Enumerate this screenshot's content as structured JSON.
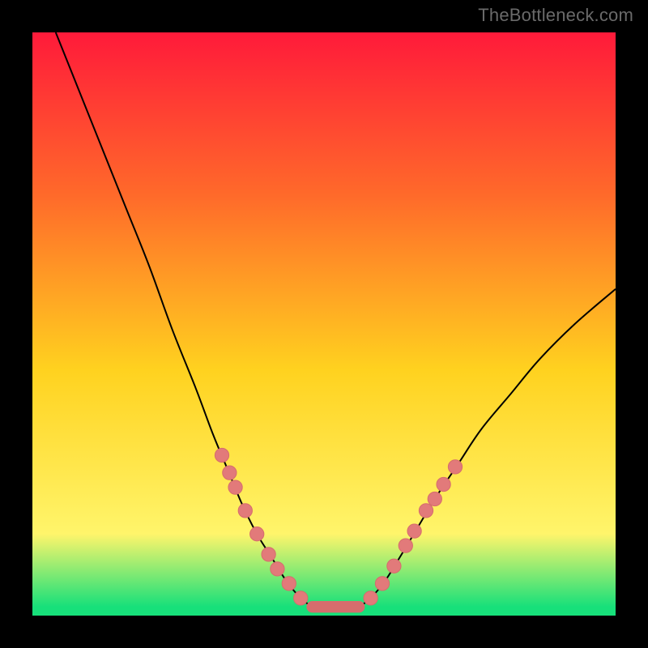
{
  "watermark": "TheBottleneck.com",
  "colors": {
    "gradient_top": "#ff1a3a",
    "gradient_mid1": "#ff6a2a",
    "gradient_mid2": "#ffd21f",
    "gradient_mid3": "#fff56b",
    "gradient_bottom": "#17e07a",
    "curve": "#000000",
    "marker_fill": "#e27a7a",
    "marker_stroke": "#d66d6d",
    "flat_line": "#d66d6d"
  },
  "chart_data": {
    "type": "line",
    "title": "",
    "xlabel": "",
    "ylabel": "",
    "xlim": [
      0,
      100
    ],
    "ylim": [
      0,
      100
    ],
    "left_curve": [
      {
        "x": 4,
        "y": 100
      },
      {
        "x": 8,
        "y": 90
      },
      {
        "x": 12,
        "y": 80
      },
      {
        "x": 16,
        "y": 70
      },
      {
        "x": 20,
        "y": 60
      },
      {
        "x": 24,
        "y": 49
      },
      {
        "x": 28,
        "y": 39
      },
      {
        "x": 31,
        "y": 31
      },
      {
        "x": 33.5,
        "y": 25
      },
      {
        "x": 36,
        "y": 19
      },
      {
        "x": 38.5,
        "y": 14
      },
      {
        "x": 41,
        "y": 10
      },
      {
        "x": 43.5,
        "y": 6
      },
      {
        "x": 46,
        "y": 3
      },
      {
        "x": 48,
        "y": 1.5
      }
    ],
    "flat_segment": {
      "x1": 48,
      "x2": 56,
      "y": 1.5
    },
    "right_curve": [
      {
        "x": 56,
        "y": 1.5
      },
      {
        "x": 58,
        "y": 3
      },
      {
        "x": 60.5,
        "y": 6
      },
      {
        "x": 63,
        "y": 10
      },
      {
        "x": 66,
        "y": 15
      },
      {
        "x": 69,
        "y": 20
      },
      {
        "x": 73,
        "y": 26
      },
      {
        "x": 77,
        "y": 32
      },
      {
        "x": 82,
        "y": 38
      },
      {
        "x": 87,
        "y": 44
      },
      {
        "x": 93,
        "y": 50
      },
      {
        "x": 100,
        "y": 56
      }
    ],
    "markers_left": [
      {
        "x": 32.5,
        "y": 27.5
      },
      {
        "x": 33.8,
        "y": 24.5
      },
      {
        "x": 34.8,
        "y": 22
      },
      {
        "x": 36.5,
        "y": 18
      },
      {
        "x": 38.5,
        "y": 14
      },
      {
        "x": 40.5,
        "y": 10.5
      },
      {
        "x": 42,
        "y": 8
      },
      {
        "x": 44,
        "y": 5.5
      },
      {
        "x": 46,
        "y": 3
      }
    ],
    "markers_right": [
      {
        "x": 58,
        "y": 3
      },
      {
        "x": 60,
        "y": 5.5
      },
      {
        "x": 62,
        "y": 8.5
      },
      {
        "x": 64,
        "y": 12
      },
      {
        "x": 65.5,
        "y": 14.5
      },
      {
        "x": 67.5,
        "y": 18
      },
      {
        "x": 69,
        "y": 20
      },
      {
        "x": 70.5,
        "y": 22.5
      },
      {
        "x": 72.5,
        "y": 25.5
      }
    ],
    "marker_radius": 1.2,
    "flat_thickness": 2.0
  }
}
